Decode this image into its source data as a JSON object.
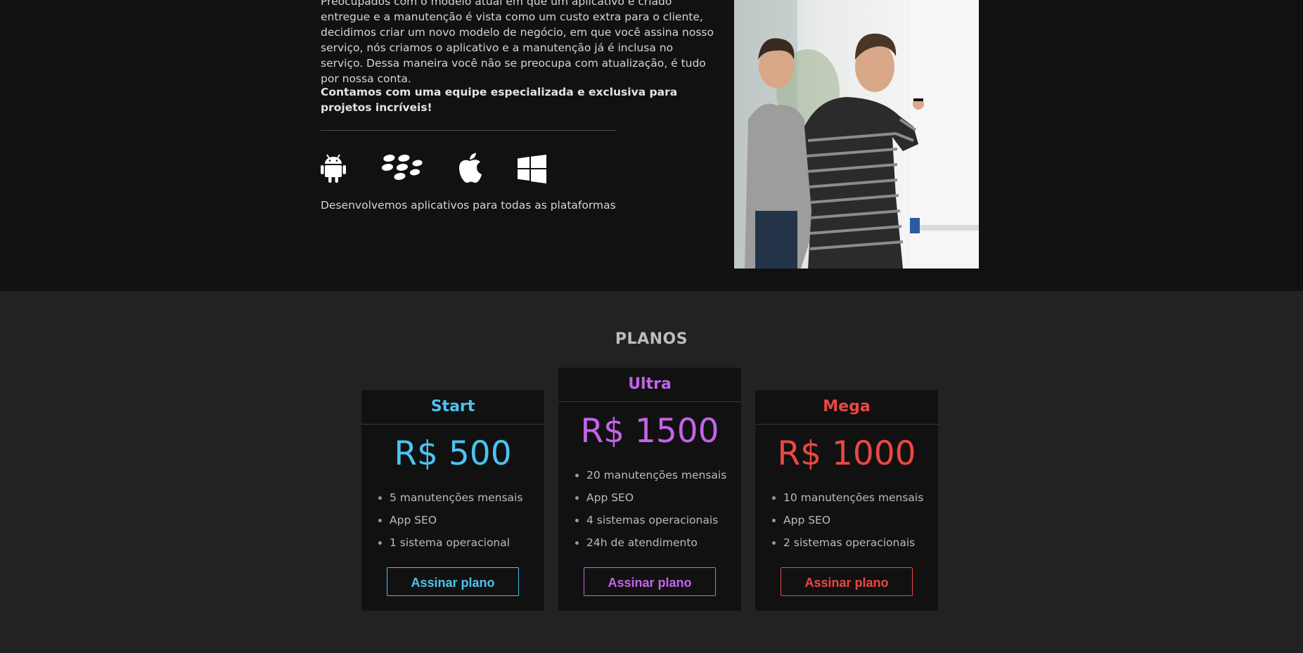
{
  "about": {
    "intro": "Preocupados com o modelo atual em que um aplicativo é criado entregue e a manutenção é vista como um custo extra para o cliente, decidimos criar um novo modelo de negócio, em que você assina nosso serviço, nós criamos o aplicativo e a manutenção já é inclusa no serviço. Dessa maneira você não se preocupa com atualização, é tudo por nossa conta.",
    "team": "Contamos com uma equipe especializada e exclusiva para projetos incríveis!",
    "platforms_caption": "Desenvolvemos aplicativos para todas as plataformas",
    "platform_icons": [
      "android-icon",
      "blackberry-icon",
      "apple-icon",
      "windows-icon"
    ]
  },
  "plans": {
    "title": "PLANOS",
    "items": [
      {
        "name": "Start",
        "price": "R$ 500",
        "features": [
          "5 manutenções mensais",
          "App SEO",
          "1 sistema operacional"
        ],
        "button": "Assinar plano",
        "color": "#4cc3ee"
      },
      {
        "name": "Ultra",
        "price": "R$ 1500",
        "features": [
          "20 manutenções mensais",
          "App SEO",
          "4 sistemas operacionais",
          "24h de atendimento"
        ],
        "button": "Assinar plano",
        "color": "#c364ea"
      },
      {
        "name": "Mega",
        "price": "R$ 1000",
        "features": [
          "10 manutenções mensais",
          "App SEO",
          "2 sistemas operacionais"
        ],
        "button": "Assinar plano",
        "color": "#ea4843"
      }
    ]
  }
}
